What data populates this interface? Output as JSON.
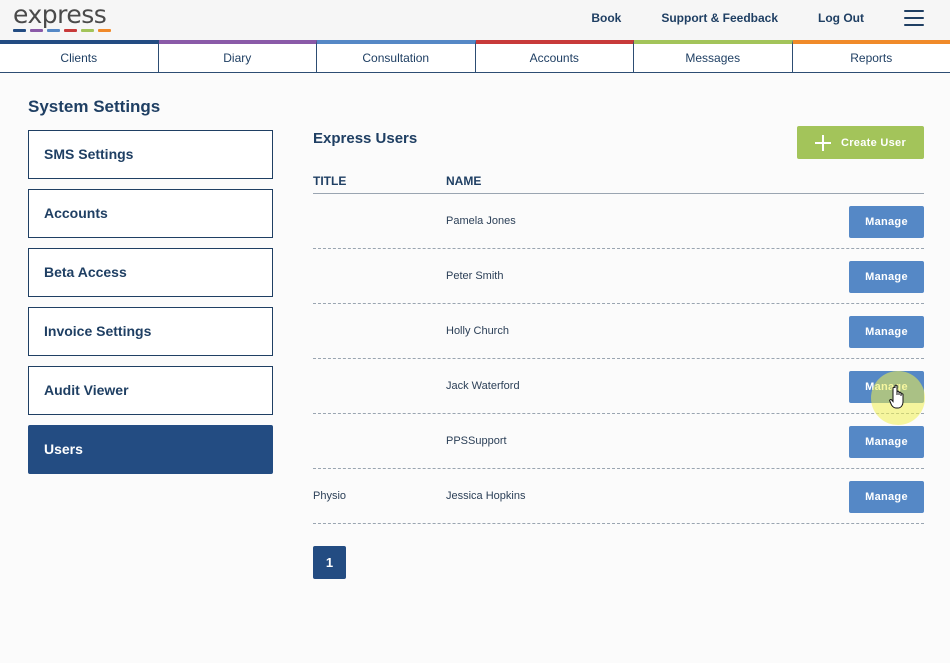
{
  "header": {
    "logo_text": "express",
    "logo_colors": [
      "#234c82",
      "#8a5aa8",
      "#5588c6",
      "#c83a3a",
      "#a3c45a",
      "#f08a2a"
    ],
    "nav": [
      {
        "label": "Book"
      },
      {
        "label": "Support & Feedback"
      },
      {
        "label": "Log Out"
      }
    ],
    "menu_icon": "hamburger-menu-icon"
  },
  "tabs": [
    {
      "label": "Clients",
      "color": "#234c82"
    },
    {
      "label": "Diary",
      "color": "#8a5aa8"
    },
    {
      "label": "Consultation",
      "color": "#5588c6"
    },
    {
      "label": "Accounts",
      "color": "#c83a3a"
    },
    {
      "label": "Messages",
      "color": "#a3c45a"
    },
    {
      "label": "Reports",
      "color": "#f08a2a"
    }
  ],
  "sidebar": {
    "title": "System Settings",
    "items": [
      {
        "label": "SMS Settings",
        "active": false
      },
      {
        "label": "Accounts",
        "active": false
      },
      {
        "label": "Beta Access",
        "active": false
      },
      {
        "label": "Invoice Settings",
        "active": false
      },
      {
        "label": "Audit Viewer",
        "active": false
      },
      {
        "label": "Users",
        "active": true
      }
    ]
  },
  "main": {
    "title": "Express Users",
    "create_button": "Create User",
    "columns": {
      "title": "TITLE",
      "name": "NAME"
    },
    "rows": [
      {
        "title": "",
        "name": "Pamela Jones",
        "action": "Manage"
      },
      {
        "title": "",
        "name": "Peter Smith",
        "action": "Manage"
      },
      {
        "title": "",
        "name": "Holly Church",
        "action": "Manage"
      },
      {
        "title": "",
        "name": "Jack Waterford",
        "action": "Manage"
      },
      {
        "title": "",
        "name": "PPSSupport",
        "action": "Manage"
      },
      {
        "title": "Physio",
        "name": "Jessica Hopkins",
        "action": "Manage"
      }
    ],
    "pagination": {
      "current_page": "1"
    }
  }
}
